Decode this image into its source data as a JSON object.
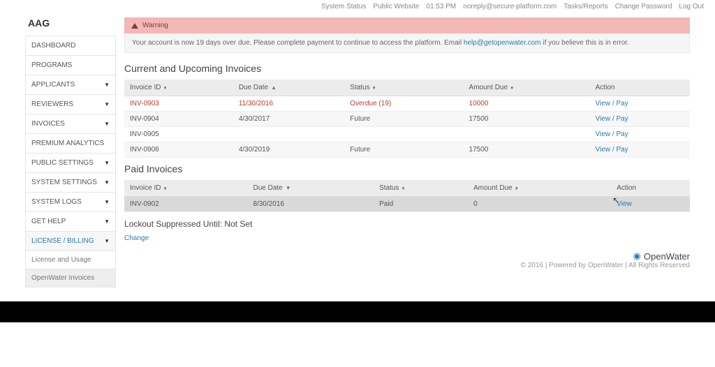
{
  "topbar": {
    "system_status": "System Status",
    "public_website": "Public Website",
    "time": "01:53 PM",
    "email": "noreply@secure-platform.com",
    "tasks": "Tasks/Reports",
    "change_password": "Change Password",
    "log_out": "Log Out"
  },
  "brand": "AAG",
  "sidebar": {
    "items": [
      {
        "label": "DASHBOARD",
        "caret": false
      },
      {
        "label": "PROGRAMS",
        "caret": false
      },
      {
        "label": "APPLICANTS",
        "caret": true
      },
      {
        "label": "REVIEWERS",
        "caret": true
      },
      {
        "label": "INVOICES",
        "caret": true
      },
      {
        "label": "PREMIUM ANALYTICS",
        "caret": false
      },
      {
        "label": "PUBLIC SETTINGS",
        "caret": true
      },
      {
        "label": "SYSTEM SETTINGS",
        "caret": true
      },
      {
        "label": "SYSTEM LOGS",
        "caret": true
      },
      {
        "label": "GET HELP",
        "caret": true
      },
      {
        "label": "LICENSE / BILLING",
        "caret": true
      }
    ],
    "subitems": [
      {
        "label": "License and Usage"
      },
      {
        "label": "OpenWater Invoices"
      }
    ]
  },
  "warning": {
    "title": "Warning",
    "body_pre": "Your account is now 19 days over due. Please complete payment to continue to access the platform. Email ",
    "body_link": "help@getopenwater.com",
    "body_post": " if you believe this is in error."
  },
  "sections": {
    "current_title": "Current and Upcoming Invoices",
    "paid_title": "Paid Invoices",
    "lockout_title": "Lockout Suppressed Until: Not Set",
    "change": "Change"
  },
  "columns": {
    "invoice_id": "Invoice ID",
    "due_date": "Due Date",
    "status": "Status",
    "amount_due": "Amount Due",
    "action": "Action"
  },
  "current_invoices": [
    {
      "id": "INV-0903",
      "due": "11/30/2016",
      "status": "Overdue (19)",
      "amount": "10000",
      "action": "View / Pay",
      "overdue": true
    },
    {
      "id": "INV-0904",
      "due": "4/30/2017",
      "status": "Future",
      "amount": "17500",
      "action": "View / Pay"
    },
    {
      "id": "INV-0905",
      "due": "",
      "status": "",
      "amount": "",
      "action": "View / Pay"
    },
    {
      "id": "INV-0906",
      "due": "4/30/2019",
      "status": "Future",
      "amount": "17500",
      "action": "View / Pay"
    }
  ],
  "paid_invoices": [
    {
      "id": "INV-0902",
      "due": "8/30/2016",
      "status": "Paid",
      "amount": "0",
      "action": "View"
    }
  ],
  "footer": {
    "brand": "OpenWater",
    "copy": "© 2016 | Powered by OpenWater | All Rights Reserved"
  }
}
